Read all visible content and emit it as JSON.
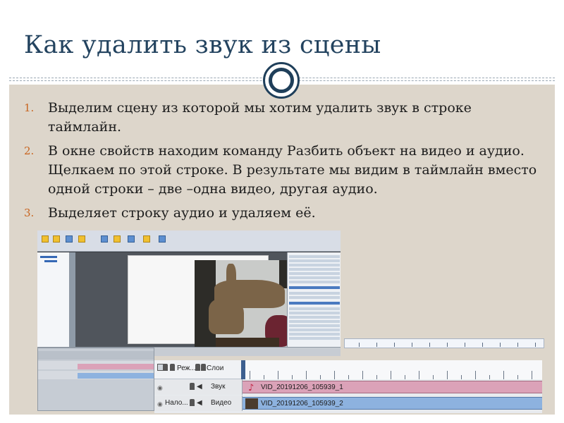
{
  "slide": {
    "title": "Как удалить звук из сцены",
    "steps": [
      {
        "number": "1.",
        "text": "Выделим сцену из которой мы хотим удалить звук в строке таймлайн."
      },
      {
        "number": "2.",
        "text": "В окне свойств находим команду Разбить объект на видео и аудио. Щелкаем по этой строке. В результате мы видим в таймлайн вместо одной строки – две –одна видео, другая аудио."
      },
      {
        "number": "3.",
        "text": "Выделяет строку аудио и удаляем её."
      }
    ],
    "colors": {
      "title": "#23435f",
      "numbers": "#c8641f",
      "background": "#ddd6cb",
      "accent": "#1f3f5a"
    }
  },
  "timeline": {
    "header": {
      "col1": "Реж...",
      "col2": "Слои"
    },
    "audio_track": {
      "label": "Звук",
      "clip_name": "VID_20191206_105939_1"
    },
    "video_track": {
      "label_left": "Нало...",
      "label": "Видео",
      "clip_name": "VID_20191206_105939_2"
    }
  },
  "icons": {
    "badge": "circle-badge-icon",
    "eye": "eye-icon",
    "lock": "lock-icon",
    "speaker": "speaker-icon",
    "note": "music-note-icon"
  }
}
